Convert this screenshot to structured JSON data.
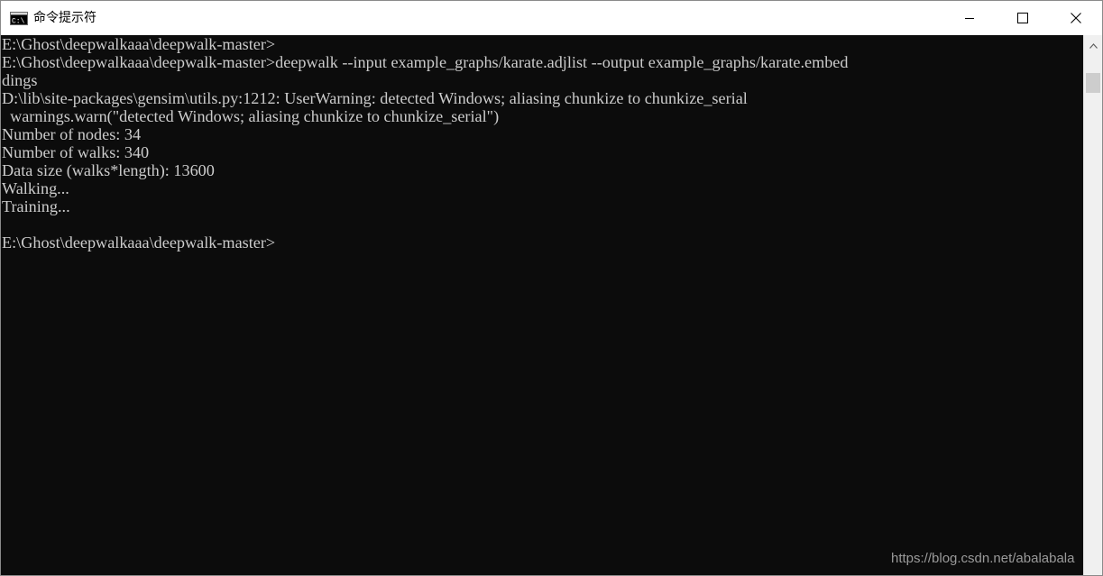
{
  "window": {
    "title": "命令提示符",
    "app_icon": "cmd-icon",
    "controls": {
      "minimize_icon": "minimize-icon",
      "maximize_icon": "maximize-icon",
      "close_icon": "close-icon"
    }
  },
  "console": {
    "lines": [
      "E:\\Ghost\\deepwalkaaa\\deepwalk-master>",
      "E:\\Ghost\\deepwalkaaa\\deepwalk-master>deepwalk --input example_graphs/karate.adjlist --output example_graphs/karate.embed",
      "dings",
      "D:\\lib\\site-packages\\gensim\\utils.py:1212: UserWarning: detected Windows; aliasing chunkize to chunkize_serial",
      "  warnings.warn(\"detected Windows; aliasing chunkize to chunkize_serial\")",
      "Number of nodes: 34",
      "Number of walks: 340",
      "Data size (walks*length): 13600",
      "Walking...",
      "Training...",
      "",
      "E:\\Ghost\\deepwalkaaa\\deepwalk-master>"
    ]
  },
  "watermark": "https://blog.csdn.net/abalabala",
  "colors": {
    "console_bg": "#0c0c0c",
    "console_fg": "#cccccc",
    "titlebar_bg": "#ffffff"
  }
}
